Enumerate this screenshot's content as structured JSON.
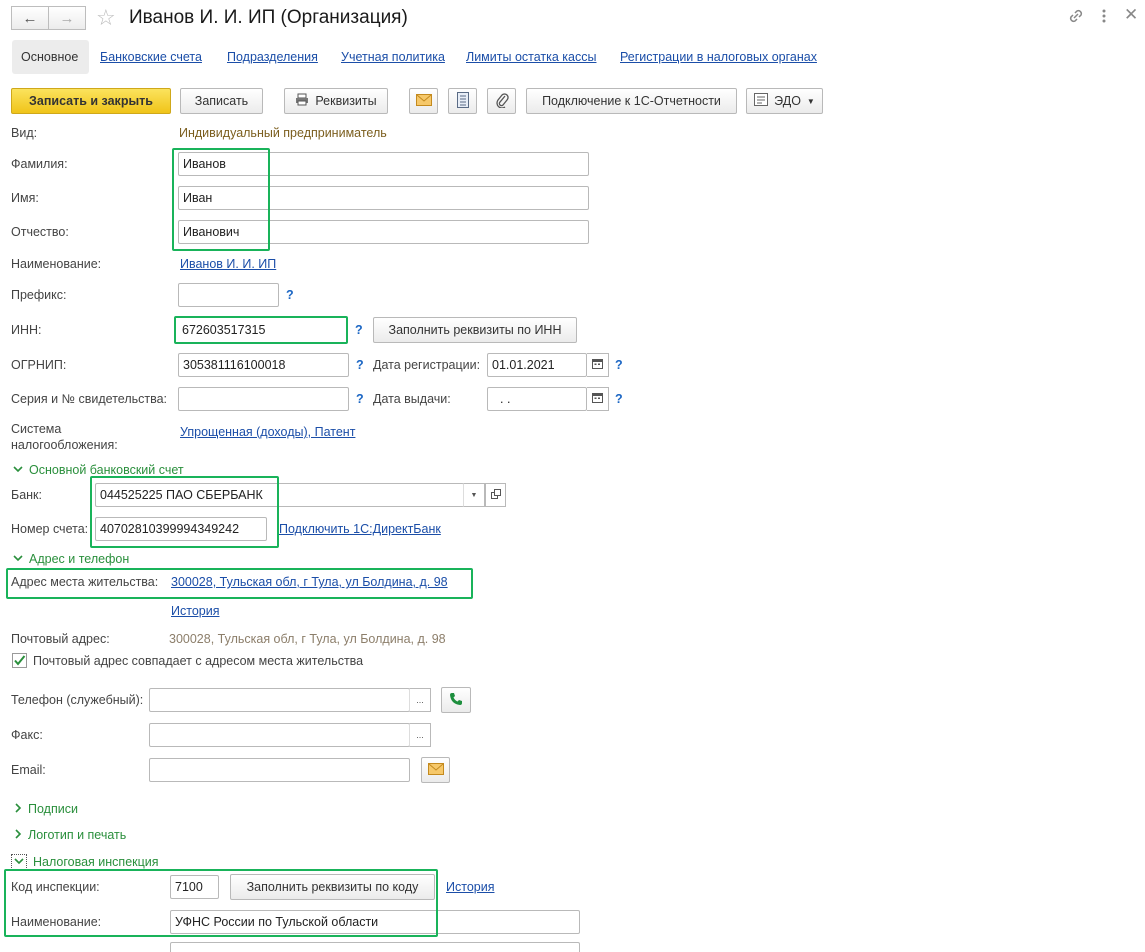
{
  "window": {
    "title": "Иванов И. И. ИП (Организация)",
    "back_icon": "arrow-left-icon",
    "forward_icon": "arrow-right-icon",
    "favorite_icon": "star-icon",
    "link_icon": "link-icon",
    "menu_icon": "more-vertical-icon",
    "close_icon": "close-icon"
  },
  "tabs": [
    {
      "label": "Основное"
    },
    {
      "label": "Банковские счета"
    },
    {
      "label": "Подразделения"
    },
    {
      "label": "Учетная политика"
    },
    {
      "label": "Лимиты остатка кассы"
    },
    {
      "label": "Регистрации в налоговых органах"
    }
  ],
  "toolbar": {
    "save_close": "Записать и закрыть",
    "save": "Записать",
    "requisites": "Реквизиты",
    "connect": "Подключение к 1С-Отчетности",
    "edo": "ЭДО"
  },
  "form": {
    "vid_label": "Вид:",
    "vid_value": "Индивидуальный предприниматель",
    "lastname_label": "Фамилия:",
    "lastname_value": "Иванов",
    "firstname_label": "Имя:",
    "firstname_value": "Иван",
    "patronymic_label": "Отчество:",
    "patronymic_value": "Иванович",
    "name_label": "Наименование:",
    "name_value": "Иванов И. И. ИП",
    "prefix_label": "Префикс:",
    "prefix_value": "",
    "inn_label": "ИНН:",
    "inn_value": "672603517315",
    "fill_by_inn": "Заполнить реквизиты по ИНН",
    "ogrnip_label": "ОГРНИП:",
    "ogrnip_value": "305381116100018",
    "reg_date_label": "Дата регистрации:",
    "reg_date_value": "01.01.2021",
    "cert_label": "Серия и № свидетельства:",
    "cert_value": "",
    "issue_date_label": "Дата выдачи:",
    "issue_date_value": " .  .",
    "tax_system_label_1": "Система",
    "tax_system_label_2": "налогообложения:",
    "tax_system_value": "Упрощенная (доходы), Патент",
    "question": "?"
  },
  "bank_section": {
    "title": "Основной банковский счет",
    "bank_label": "Банк:",
    "bank_value": "044525225 ПАО СБЕРБАНК",
    "account_label": "Номер счета:",
    "account_value": "40702810399994349242",
    "directbank_link": "Подключить 1С:ДиректБанк"
  },
  "address_section": {
    "title": "Адрес и телефон",
    "residence_label": "Адрес места жительства:",
    "residence_value": "300028, Тульская обл, г Тула, ул Болдина, д. 98",
    "history_link": "История",
    "postal_label": "Почтовый адрес:",
    "postal_value": "300028, Тульская обл, г Тула, ул Болдина, д. 98",
    "postal_same_label": "Почтовый адрес совпадает с адресом места жительства",
    "postal_same_checked": true,
    "phone_label": "Телефон (служебный):",
    "phone_value": "",
    "fax_label": "Факс:",
    "fax_value": "",
    "email_label": "Email:",
    "email_value": "",
    "ellipsis": "..."
  },
  "signatures_section": {
    "title": "Подписи"
  },
  "logo_section": {
    "title": "Логотип и печать"
  },
  "tax_section": {
    "title": "Налоговая инспекция",
    "code_label": "Код инспекции:",
    "code_value": "7100",
    "fill_by_code": "Заполнить реквизиты по коду",
    "history_link": "История",
    "name_label": "Наименование:",
    "name_value": "УФНС России по Тульской области"
  },
  "colors": {
    "accent_yellow": "#f0c419",
    "link_blue": "#1b4ea8",
    "section_green": "#2a8f3c",
    "highlight_green": "#19b35a",
    "value_brown": "#7b5e1e"
  }
}
